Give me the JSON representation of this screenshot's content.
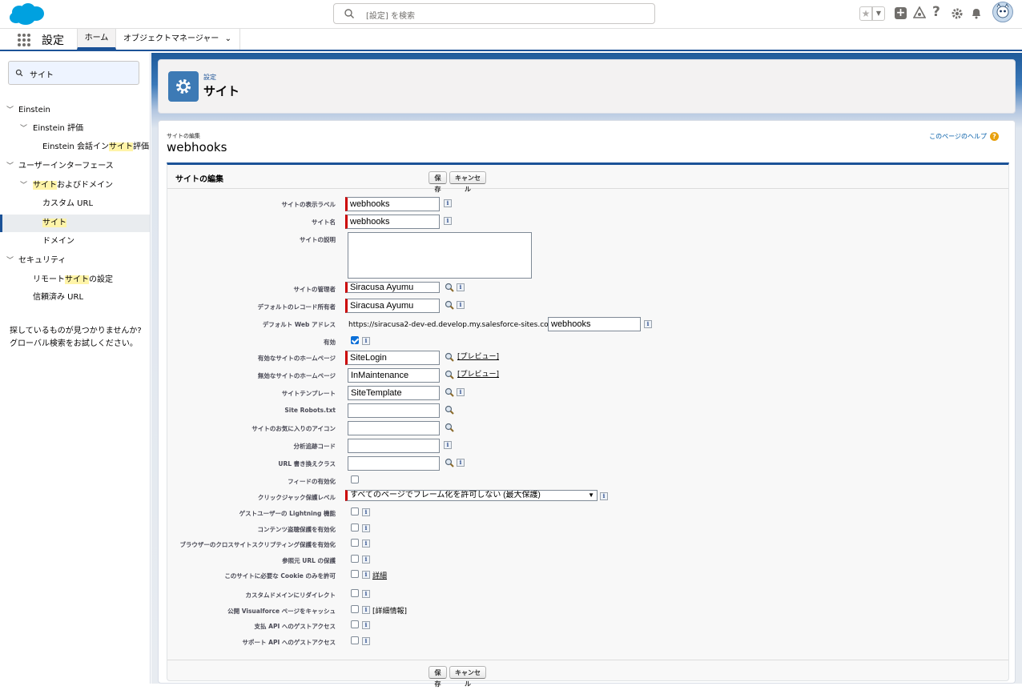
{
  "header": {
    "search_placeholder": "[設定] を検索",
    "app_name": "設定",
    "tab_home": "ホーム",
    "tab_object_manager": "オブジェクトマネージャー"
  },
  "sidebar": {
    "quick_find_value": "サイト",
    "items": [
      {
        "text": "Einstein"
      },
      {
        "text": "Einstein 評価"
      },
      {
        "pre": "Einstein 会話イン",
        "hl": "サイト",
        "post": "評価"
      },
      {
        "text": "ユーザーインターフェース"
      },
      {
        "pre": "",
        "hl": "サイト",
        "post": "およびドメイン"
      },
      {
        "text": "カスタム URL"
      },
      {
        "pre": "",
        "hl": "サイト",
        "post": ""
      },
      {
        "text": "ドメイン"
      },
      {
        "text": "セキュリティ"
      },
      {
        "pre": "リモート",
        "hl": "サイト",
        "post": "の設定"
      },
      {
        "text": "信頼済み URL"
      }
    ],
    "not_found_line1": "探しているものが見つかりませんか?",
    "not_found_line2": "グローバル検索をお試しください。"
  },
  "page_header": {
    "breadcrumb": "設定",
    "title": "サイト"
  },
  "content": {
    "subtitle": "サイトの編集",
    "title": "webhooks",
    "help_link": "このページのヘルプ",
    "block_title": "サイトの編集",
    "save": "保存",
    "cancel": "キャンセル"
  },
  "form": {
    "site_label_lbl": "サイトの表示ラベル",
    "site_label_val": "webhooks",
    "site_name_lbl": "サイト名",
    "site_name_val": "webhooks",
    "site_desc_lbl": "サイトの説明",
    "site_admin_lbl": "サイトの管理者",
    "site_admin_val": "Siracusa Ayumu",
    "default_owner_lbl": "デフォルトのレコード所有者",
    "default_owner_val": "Siracusa Ayumu",
    "web_address_lbl": "デフォルト Web アドレス",
    "web_address_prefix": "https://siracusa2-dev-ed.develop.my.salesforce-sites.com/",
    "web_address_val": "webhooks",
    "active_lbl": "有効",
    "active_home_lbl": "有効なサイトのホームページ",
    "active_home_val": "SiteLogin",
    "inactive_home_lbl": "無効なサイトのホームページ",
    "inactive_home_val": "InMaintenance",
    "preview": "[プレビュー]",
    "template_lbl": "サイトテンプレート",
    "template_val": "SiteTemplate",
    "robots_lbl": "Site Robots.txt",
    "favicon_lbl": "サイトのお気に入りのアイコン",
    "analytics_lbl": "分析追跡コード",
    "url_rewriter_lbl": "URL 書き換えクラス",
    "feeds_lbl": "フィードの有効化",
    "clickjack_lbl": "クリックジャック保護レベル",
    "clickjack_val": "すべてのページでフレーム化を許可しない (最大保護)",
    "guest_lightning_lbl": "ゲストユーザーの Lightning 機能",
    "content_sniff_lbl": "コンテンツ盗聴保護を有効化",
    "xss_lbl": "ブラウザーのクロスサイトスクリプティング保護を有効化",
    "referrer_lbl": "参照元 URL の保護",
    "cookie_lbl": "このサイトに必要な Cookie のみを許可",
    "cookie_detail": "詳細",
    "redirect_lbl": "カスタムドメインにリダイレクト",
    "vf_cache_lbl": "公開 Visualforce ページをキャッシュ",
    "vf_cache_detail": "[詳細情報]",
    "payment_api_lbl": "支払 API へのゲストアクセス",
    "support_api_lbl": "サポート API へのゲストアクセス"
  },
  "colors": {
    "brand_blue": "#1b5297",
    "required_red": "#cc0000",
    "highlight": "#fff4a8"
  }
}
